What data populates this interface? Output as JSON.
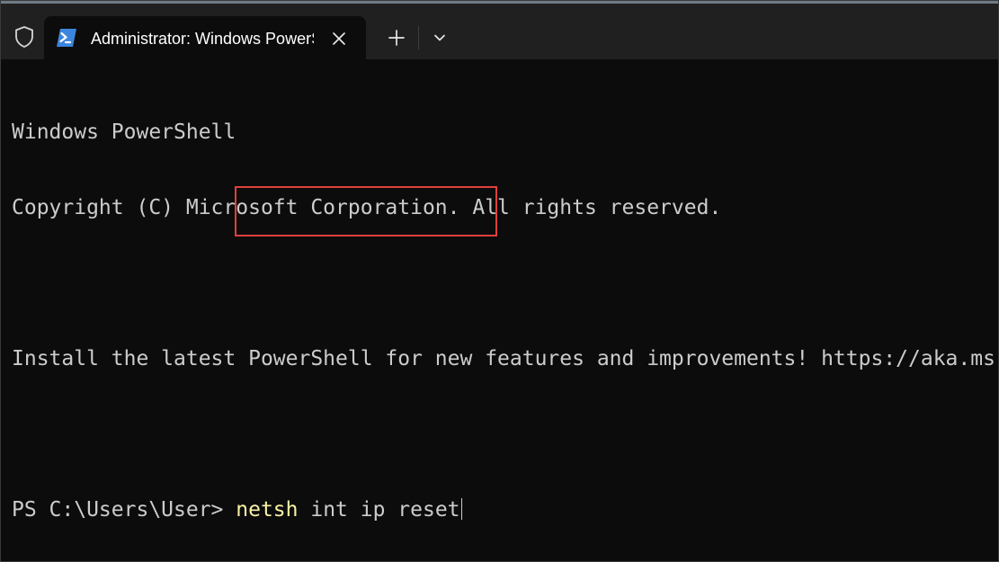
{
  "window": {
    "tab_title": "Administrator: Windows PowerShell"
  },
  "titlebar": {
    "icons": {
      "admin": "shield-icon",
      "tab": "powershell-icon",
      "close": "close-icon",
      "new_tab": "plus-icon",
      "dropdown": "chevron-down-icon"
    }
  },
  "terminal": {
    "header_line_1": "Windows PowerShell",
    "header_line_2": "Copyright (C) Microsoft Corporation. All rights reserved.",
    "install_line": "Install the latest PowerShell for new features and improvements! https://aka.ms/PSWindows",
    "prompt": "PS C:\\Users\\User> ",
    "command_name": "netsh",
    "command_args": " int ip reset"
  },
  "colors": {
    "background": "#0c0c0c",
    "titlebar": "#202020",
    "text": "#cccccc",
    "command": "#f9f1a5",
    "highlight": "#e0403d"
  }
}
